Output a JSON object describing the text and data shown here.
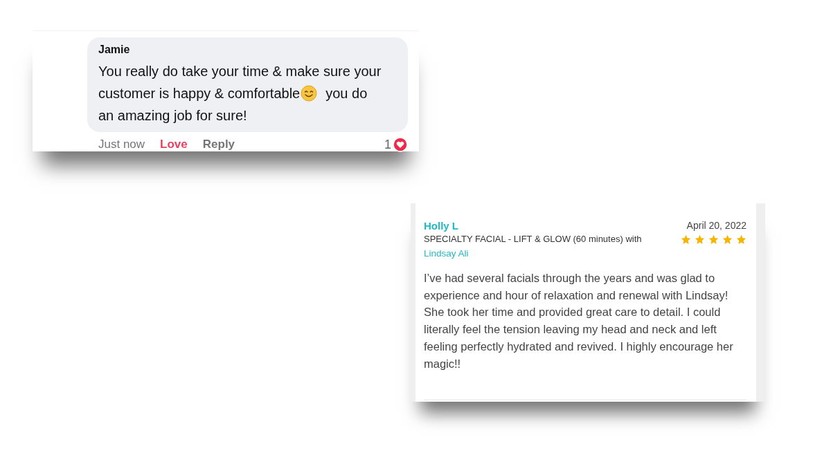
{
  "comment": {
    "author": "Jamie",
    "lines": [
      [
        "You really do take your time & make sure your"
      ],
      [
        "customer is happy & comfortable",
        "you do"
      ],
      [
        "an amazing job for sure!"
      ]
    ],
    "time": "Just now",
    "love_label": "Love",
    "loved": true,
    "reply_label": "Reply",
    "reaction_count": "1"
  },
  "review": {
    "author": "Holly L",
    "service": "SPECIALTY FACIAL - LIFT & GLOW (60 minutes) with",
    "provider": "Lindsay Ali",
    "date": "April 20, 2022",
    "stars": 5,
    "text": "I’ve had several facials through the years and was glad to experience and hour of relaxation and renewal with Lindsay! She took her time and provided great care to detail. I could literally feel the tension leaving my head and neck and left feeling perfectly hydrated and revived. I highly encourage her magic!!"
  }
}
